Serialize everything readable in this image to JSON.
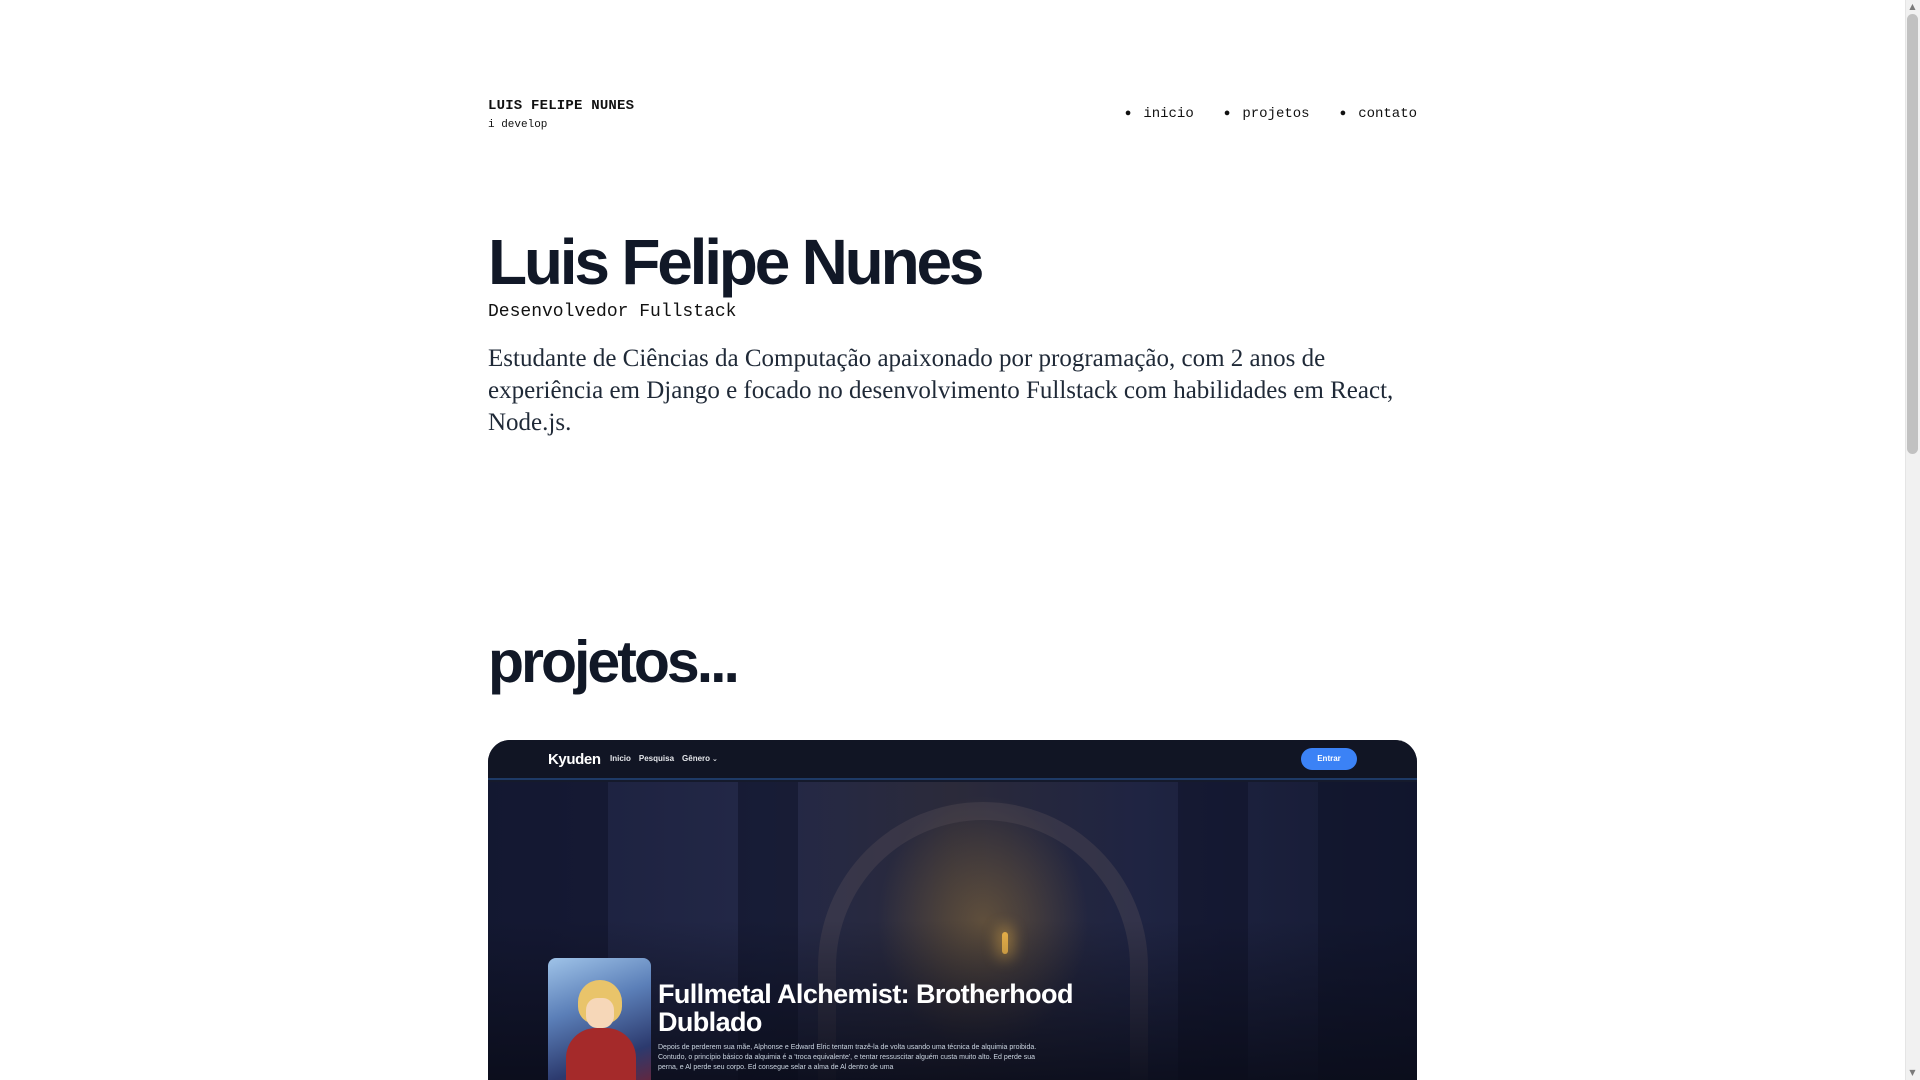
{
  "header": {
    "brand_name": "LUIS FELIPE NUNES",
    "tagline": "i develop",
    "nav": [
      {
        "label": "inicio"
      },
      {
        "label": "projetos"
      },
      {
        "label": "contato"
      }
    ]
  },
  "hero": {
    "title": "Luis Felipe Nunes",
    "subtitle": "Desenvolvedor Fullstack",
    "bio": "Estudante de Ciências da Computação apaixonado por programação, com 2 anos de experiência em Django e focado no desenvolvimento Fullstack com habilidades em React, Node.js."
  },
  "projects": {
    "section_title": "projetos...",
    "card": {
      "site_name": "Kyuden",
      "nav_links": [
        "Inicio",
        "Pesquisa",
        "Gênero"
      ],
      "login_label": "Entrar",
      "anime_title": "Fullmetal Alchemist: Brotherhood Dublado",
      "anime_description": "Depois de perderem sua mãe, Alphonse e Edward Elric tentam trazê-la de volta usando uma técnica de alquimia proibida. Contudo, o princípio básico da alquimia é a 'troca equivalente', e tentar ressuscitar alguém custa muito alto. Ed perde sua perna, e Al perde seu corpo. Ed consegue selar a alma de Al dentro de uma"
    }
  },
  "colors": {
    "heading": "#111827",
    "card_background": "#151a2c",
    "login_button": "#3b82f6"
  }
}
